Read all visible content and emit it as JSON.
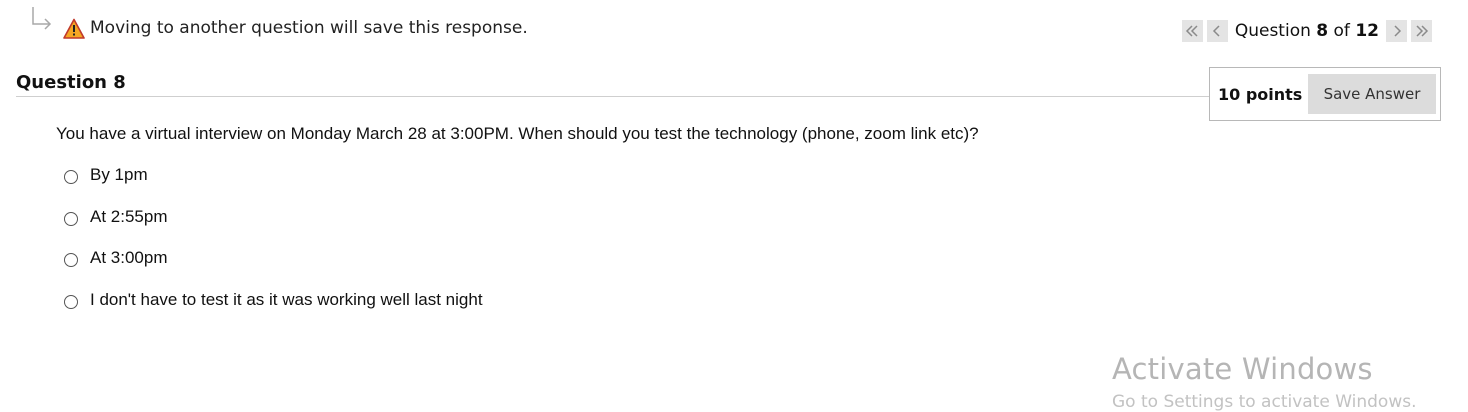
{
  "notice": {
    "text": "Moving to another question will save this response."
  },
  "pager": {
    "prefix": "Question ",
    "current": "8",
    "of_label": " of ",
    "total": "12"
  },
  "question": {
    "title": "Question 8",
    "points": "10 points",
    "save_label": "Save Answer",
    "prompt": "You have a virtual interview on Monday March 28 at  3:00PM. When should you test the technology (phone, zoom link etc)?",
    "options": [
      {
        "label": "By 1pm",
        "selected": false
      },
      {
        "label": "At 2:55pm",
        "selected": false
      },
      {
        "label": "At 3:00pm",
        "selected": false
      },
      {
        "label": "I don't have to test it as it was working well last night",
        "selected": false
      }
    ]
  },
  "watermark": {
    "title": "Activate Windows",
    "subtitle": "Go to Settings to activate Windows."
  },
  "colors": {
    "warning_fill": "#f5a623",
    "pager_button": "#e4e4e4",
    "save_button": "#dcdcdc"
  },
  "icons": [
    "arrow-icon",
    "warning-icon",
    "double-chevron-left-icon",
    "chevron-left-icon",
    "chevron-right-icon",
    "double-chevron-right-icon"
  ]
}
